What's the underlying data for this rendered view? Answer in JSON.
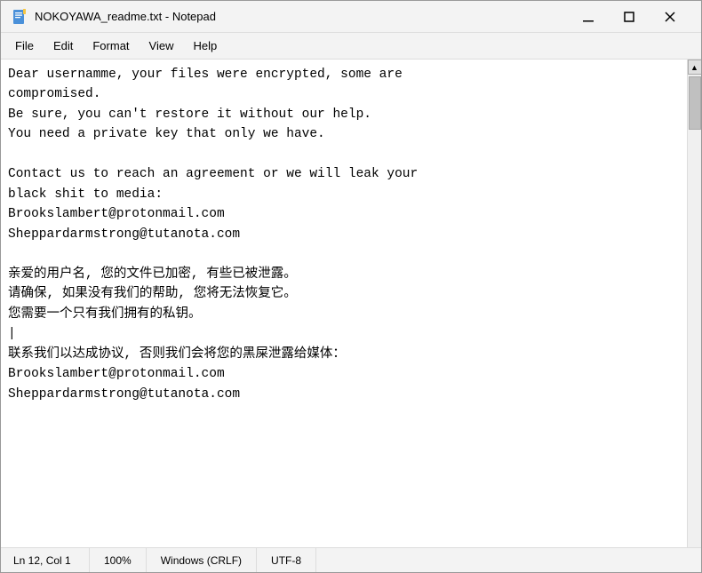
{
  "window": {
    "title": "NOKOYAWA_readme.txt - Notepad",
    "icon": "notepad"
  },
  "titlebar": {
    "minimize_label": "minimize",
    "maximize_label": "maximize",
    "close_label": "close"
  },
  "menubar": {
    "items": [
      {
        "id": "file",
        "label": "File"
      },
      {
        "id": "edit",
        "label": "Edit"
      },
      {
        "id": "format",
        "label": "Format"
      },
      {
        "id": "view",
        "label": "View"
      },
      {
        "id": "help",
        "label": "Help"
      }
    ]
  },
  "editor": {
    "content": "Dear usernamme, your files were encrypted, some are\ncompromised.\nBe sure, you can't restore it without our help.\nYou need a private key that only we have.\n\nContact us to reach an agreement or we will leak your\nblack shit to media:\nBrookslambert@protonmail.com\nSheppardarmstrong@tutanota.com\n\n亲爱的用户名, 您的文件已加密, 有些已被泄露。\n请确保, 如果没有我们的帮助, 您将无法恢复它。\n您需要一个只有我们拥有的私钥。\n|\n联系我们以达成协议, 否则我们会将您的黑屎泄露给媒体：\nBrookslambert@protonmail.com\nSheppardarmstrong@tutanota.com"
  },
  "statusbar": {
    "position": "Ln 12, Col 1",
    "zoom": "100%",
    "line_ending": "Windows (CRLF)",
    "encoding": "UTF-8"
  }
}
